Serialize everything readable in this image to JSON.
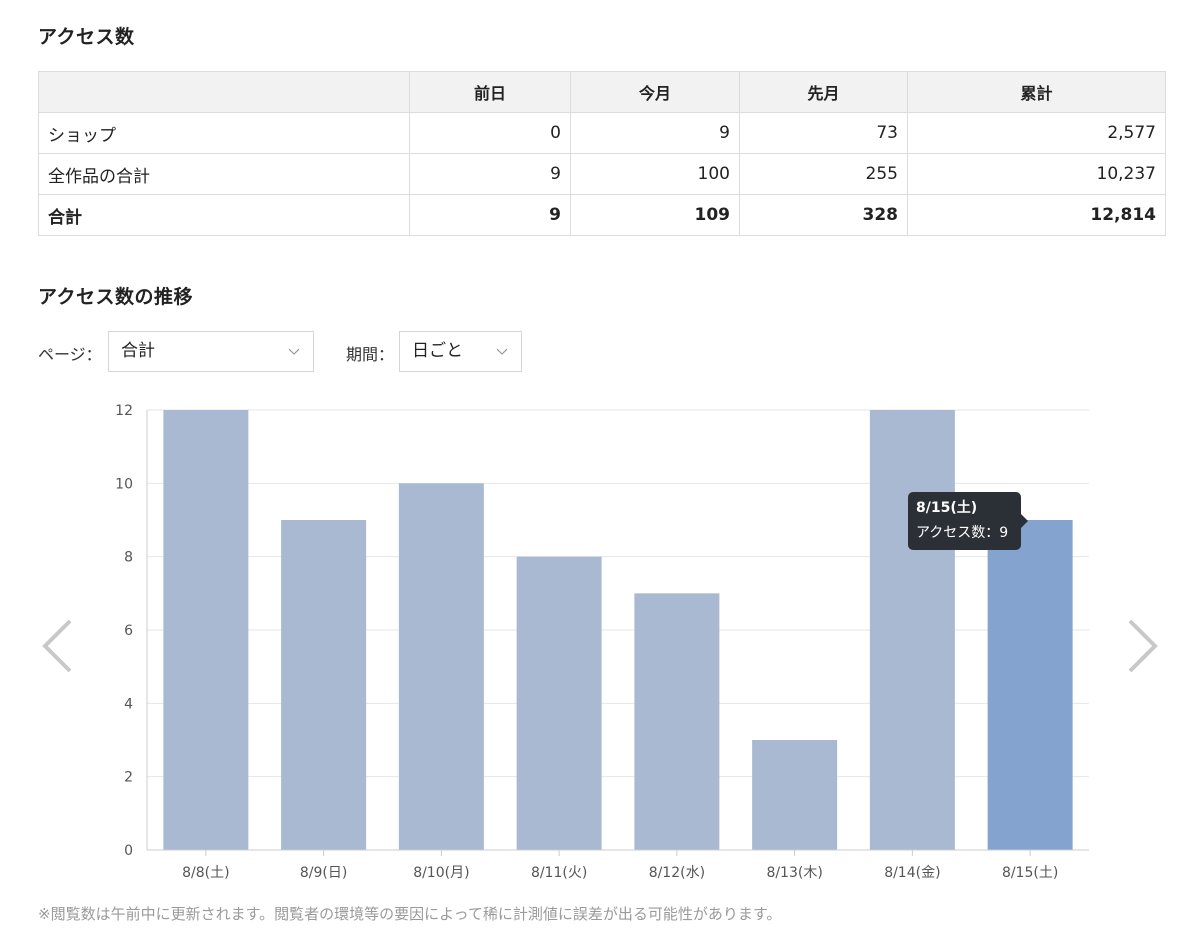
{
  "access_section": {
    "title": "アクセス数"
  },
  "table": {
    "headers": [
      "",
      "前日",
      "今月",
      "先月",
      "累計"
    ],
    "rows": [
      {
        "label": "ショップ",
        "values": [
          "0",
          "9",
          "73",
          "2,577"
        ]
      },
      {
        "label": "全作品の合計",
        "values": [
          "9",
          "100",
          "255",
          "10,237"
        ]
      },
      {
        "label": "合計",
        "values": [
          "9",
          "109",
          "328",
          "12,814"
        ]
      }
    ]
  },
  "trend_section": {
    "title": "アクセス数の推移"
  },
  "controls": {
    "page_label": "ページ：",
    "page_value": "合計",
    "period_label": "期間：",
    "period_value": "日ごと"
  },
  "nav": {
    "prev_icon": "chevron-left-icon",
    "next_icon": "chevron-right-icon"
  },
  "chart_data": {
    "type": "bar",
    "categories": [
      "8/8(土)",
      "8/9(日)",
      "8/10(月)",
      "8/11(火)",
      "8/12(水)",
      "8/13(木)",
      "8/14(金)",
      "8/15(土)"
    ],
    "series": [
      {
        "values": [
          12,
          9,
          10,
          8,
          7,
          3,
          12,
          9
        ]
      }
    ],
    "ylim": [
      0,
      12
    ],
    "yticks": [
      0,
      2,
      4,
      6,
      8,
      10,
      12
    ],
    "grid": true,
    "highlight_index": 7,
    "colors": {
      "bar": "#aab9d2",
      "highlight": "#84a3ce",
      "grid": "#e6e6e6",
      "tick": "#555555"
    }
  },
  "tooltip": {
    "title": "8/15(土)",
    "body": "アクセス数：9"
  },
  "footnote": "※閲覧数は午前中に更新されます。閲覧者の環境等の要因によって稀に計測値に誤差が出る可能性があります。"
}
